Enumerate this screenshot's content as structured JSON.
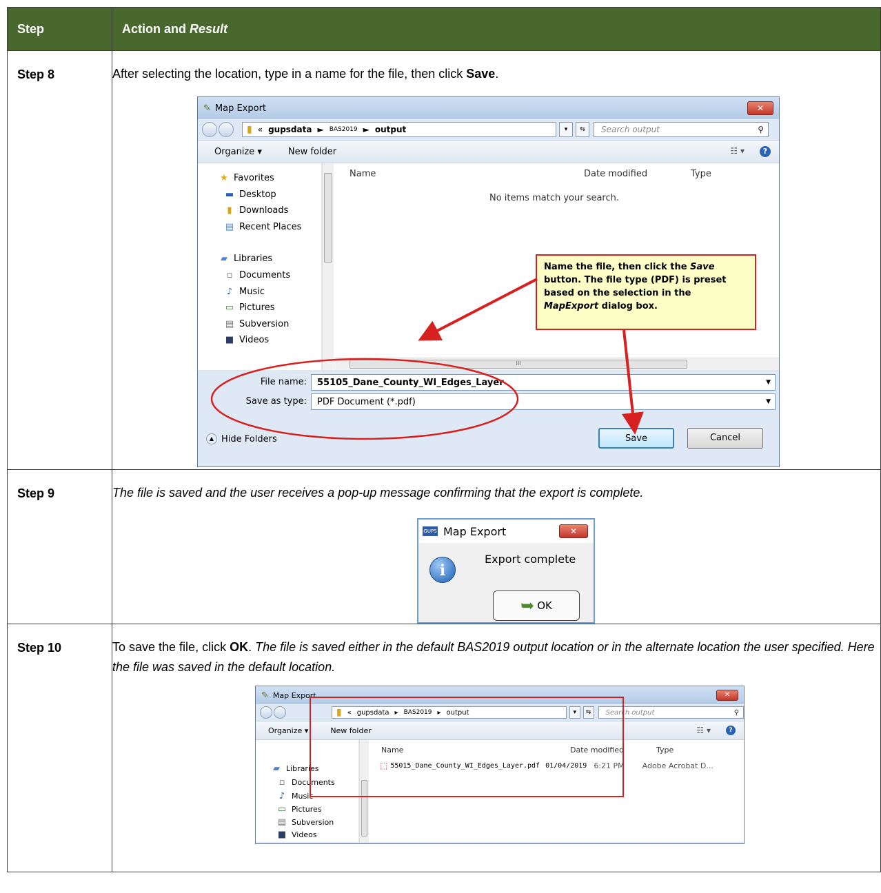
{
  "table": {
    "header_step": "Step",
    "header_action": "Action and ",
    "header_action_italic": "Result"
  },
  "steps": [
    {
      "label": "Step 8",
      "text_before": "After selecting the location, type in a name for the file, then click ",
      "text_bold": "Save",
      "text_after": "."
    },
    {
      "label": "Step 9",
      "text_italic": "The file is saved and the user receives a pop-up message confirming that the export is complete."
    },
    {
      "label": "Step 10",
      "text_before": "To save the file, click ",
      "text_bold": "OK",
      "text_after": ". ",
      "text_italic": "The file is saved either in the default BAS2019 output location or in the alternate location the user specified. Here the file was saved in the default location."
    }
  ],
  "dialog_save": {
    "title": "Map Export",
    "close": "✕",
    "breadcrumb": {
      "prefix": "«",
      "part1": "gupsdata",
      "part2": "BAS2019",
      "part3": "output",
      "sep": "►"
    },
    "search_placeholder": "Search output",
    "organize": "Organize ▾",
    "new_folder": "New folder",
    "nav": {
      "favorites": "Favorites",
      "desktop": "Desktop",
      "downloads": "Downloads",
      "recent_places": "Recent Places",
      "libraries": "Libraries",
      "documents": "Documents",
      "music": "Music",
      "pictures": "Pictures",
      "subversion": "Subversion",
      "videos": "Videos"
    },
    "columns": {
      "name": "Name",
      "date_modified": "Date modified",
      "type": "Type"
    },
    "empty_message": "No items match your search.",
    "file_name_label": "File name:",
    "file_name_value": "55105_Dane_County_WI_Edges_Layer",
    "save_as_type_label": "Save as type:",
    "save_as_type_value": "PDF Document (*.pdf)",
    "hide_folders": "Hide Folders",
    "save_button": "Save",
    "cancel_button": "Cancel",
    "callout": {
      "line1a": "Name the file, then click the ",
      "line1b": "Save",
      "line2": " button. The file type (PDF) is preset based on the selection in the ",
      "line3": "MapExport",
      "line4": " dialog box."
    }
  },
  "dialog_popup": {
    "title": "Map Export",
    "app_icon": "GUPS",
    "close": "✕",
    "message": "Export complete",
    "ok_button": "OK"
  },
  "dialog_result": {
    "title": "Map Export",
    "close": "✕",
    "breadcrumb": {
      "prefix": "«",
      "part1": "gupsdata",
      "part2": "BAS2019",
      "part3": "output",
      "sep": "▸"
    },
    "search_placeholder": "Search output",
    "organize": "Organize ▾",
    "new_folder": "New folder",
    "nav": {
      "libraries": "Libraries",
      "documents": "Documents",
      "music": "Music",
      "pictures": "Pictures",
      "subversion": "Subversion",
      "videos": "Videos"
    },
    "columns": {
      "name": "Name",
      "date_modified": "Date modified",
      "type": "Type"
    },
    "file": {
      "name": "55015_Dane_County_WI_Edges_Layer.pdf",
      "date": "01/04/2019",
      "time": "6:21 PM",
      "type": "Adobe Acrobat D..."
    }
  },
  "colors": {
    "header_bg": "#49682e",
    "callout_border": "#d72020",
    "callout_bg": "#fdfdc6"
  }
}
